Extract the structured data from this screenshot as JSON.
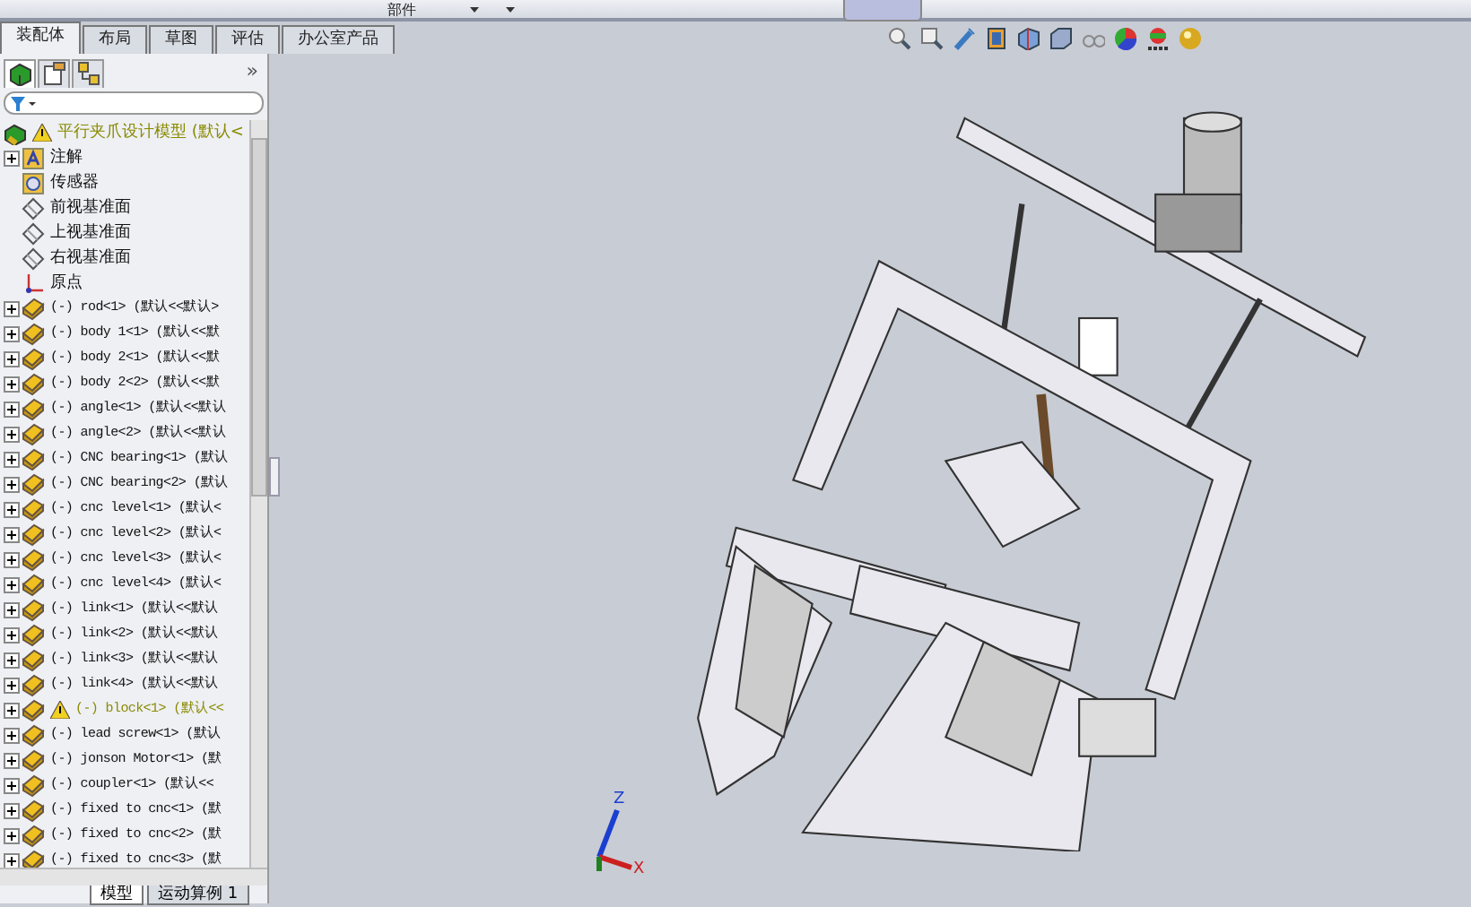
{
  "ribbon": {
    "label": "部件"
  },
  "tabs": [
    {
      "label": "装配体",
      "selected": true
    },
    {
      "label": "布局",
      "selected": false
    },
    {
      "label": "草图",
      "selected": false
    },
    {
      "label": "评估",
      "selected": false
    },
    {
      "label": "办公室产品",
      "selected": false
    }
  ],
  "panel_tabs": [
    {
      "kind": "tree",
      "selected": true
    },
    {
      "kind": "property",
      "selected": false
    },
    {
      "kind": "config",
      "selected": false
    }
  ],
  "panel_more": "»",
  "tree": {
    "root": {
      "label": "平行夹爪设计模型  (默认<",
      "warning": true
    },
    "items": [
      {
        "kind": "annotation",
        "label": "注解",
        "expandable": true,
        "warning": false
      },
      {
        "kind": "sensor",
        "label": "传感器",
        "expandable": false,
        "warning": false
      },
      {
        "kind": "plane",
        "label": "前视基准面",
        "expandable": false,
        "warning": false
      },
      {
        "kind": "plane",
        "label": "上视基准面",
        "expandable": false,
        "warning": false
      },
      {
        "kind": "plane",
        "label": "右视基准面",
        "expandable": false,
        "warning": false
      },
      {
        "kind": "origin",
        "label": "原点",
        "expandable": false,
        "warning": false
      },
      {
        "kind": "part",
        "label": "(-) rod<1> (默认<<默认>",
        "expandable": true,
        "warning": false
      },
      {
        "kind": "part",
        "label": "(-) body 1<1> (默认<<默",
        "expandable": true,
        "warning": false
      },
      {
        "kind": "part",
        "label": "(-) body 2<1> (默认<<默",
        "expandable": true,
        "warning": false
      },
      {
        "kind": "part",
        "label": "(-) body 2<2> (默认<<默",
        "expandable": true,
        "warning": false
      },
      {
        "kind": "part",
        "label": "(-) angle<1> (默认<<默认",
        "expandable": true,
        "warning": false
      },
      {
        "kind": "part",
        "label": "(-) angle<2> (默认<<默认",
        "expandable": true,
        "warning": false
      },
      {
        "kind": "part",
        "label": "(-) CNC bearing<1> (默认",
        "expandable": true,
        "warning": false
      },
      {
        "kind": "part",
        "label": "(-) CNC bearing<2> (默认",
        "expandable": true,
        "warning": false
      },
      {
        "kind": "part",
        "label": "(-) cnc level<1> (默认<",
        "expandable": true,
        "warning": false
      },
      {
        "kind": "part",
        "label": "(-) cnc level<2> (默认<",
        "expandable": true,
        "warning": false
      },
      {
        "kind": "part",
        "label": "(-) cnc level<3> (默认<",
        "expandable": true,
        "warning": false
      },
      {
        "kind": "part",
        "label": "(-) cnc level<4> (默认<",
        "expandable": true,
        "warning": false
      },
      {
        "kind": "part",
        "label": "(-) link<1> (默认<<默认",
        "expandable": true,
        "warning": false
      },
      {
        "kind": "part",
        "label": "(-) link<2> (默认<<默认",
        "expandable": true,
        "warning": false
      },
      {
        "kind": "part",
        "label": "(-) link<3> (默认<<默认",
        "expandable": true,
        "warning": false
      },
      {
        "kind": "part",
        "label": "(-) link<4> (默认<<默认",
        "expandable": true,
        "warning": false
      },
      {
        "kind": "part",
        "label": "(-) block<1> (默认<<",
        "expandable": true,
        "warning": true
      },
      {
        "kind": "part",
        "label": "(-) lead screw<1> (默认",
        "expandable": true,
        "warning": false
      },
      {
        "kind": "part",
        "label": "(-) jonson Motor<1> (默",
        "expandable": true,
        "warning": false
      },
      {
        "kind": "part",
        "label": "(-) coupler<1> (默认<<",
        "expandable": true,
        "warning": false
      },
      {
        "kind": "part",
        "label": "(-) fixed to cnc<1> (默",
        "expandable": true,
        "warning": false
      },
      {
        "kind": "part",
        "label": "(-) fixed to cnc<2> (默",
        "expandable": true,
        "warning": false
      },
      {
        "kind": "part",
        "label": "(-) fixed to cnc<3> (默",
        "expandable": true,
        "warning": false
      }
    ]
  },
  "view_toolbar": [
    {
      "kind": "zoom-fit"
    },
    {
      "kind": "zoom-area"
    },
    {
      "kind": "previous-view"
    },
    {
      "kind": "section"
    },
    {
      "kind": "view-orientation"
    },
    {
      "kind": "display-style"
    },
    {
      "kind": "hide-show"
    },
    {
      "kind": "appearance"
    },
    {
      "kind": "scene"
    },
    {
      "kind": "render"
    }
  ],
  "triad": {
    "x": "X",
    "z": "Z"
  },
  "bottom_tabs": [
    {
      "label": "模型",
      "selected": true
    },
    {
      "label": "运动算例 1",
      "selected": false
    }
  ]
}
